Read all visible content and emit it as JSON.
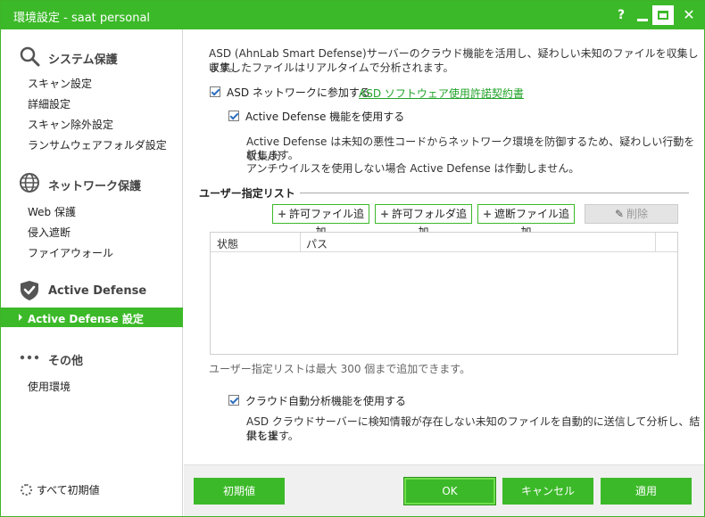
{
  "window": {
    "title": "環境設定 - saat personal",
    "help_label": "?",
    "close_label": "✕"
  },
  "sidebar": {
    "sections": [
      {
        "icon": "search-icon",
        "label": "システム保護",
        "items": [
          "スキャン設定",
          "詳細設定",
          "スキャン除外設定",
          "ランサムウェアフォルダ設定"
        ]
      },
      {
        "icon": "globe-icon",
        "label": "ネットワーク保護",
        "items": [
          "Web 保護",
          "侵入遮断",
          "ファイアウォール"
        ]
      },
      {
        "icon": "shield-check-icon",
        "label": "Active Defense",
        "items": [
          "Active Defense 設定"
        ]
      },
      {
        "icon": "more-icon",
        "label": "その他",
        "items": [
          "使用環境"
        ]
      }
    ],
    "active_item": "Active Defense 設定",
    "reset_all_label": "すべて初期値"
  },
  "content": {
    "intro_line1": "ASD (AhnLab Smart Defense)サーバーのクラウド機能を活用し、疑わしい未知のファイルを収集します。",
    "intro_line2": "収集したファイルはリアルタイムで分析されます。",
    "asd_checkbox": {
      "label": "ASD ネットワークに参加する",
      "checked": true
    },
    "license_link": "ASD ソフトウェア使用許諾契約書",
    "active_defense_checkbox": {
      "label": "Active Defense 機能を使用する",
      "checked": true
    },
    "ad_desc_line1": "Active Defense は未知の悪性コードからネットワーク環境を防御するため、疑わしい行動を収集/分",
    "ad_desc_line2": "析します。",
    "ad_desc_line3": "アンチウイルスを使用しない場合 Active Defense は作動しません。",
    "user_list_title": "ユーザー指定リスト",
    "buttons": {
      "add_file": "許可ファイル追加",
      "add_folder": "許可フォルダ追加",
      "block_file": "遮断ファイル追加",
      "delete": "削除"
    },
    "table": {
      "columns": [
        "状態",
        "パス"
      ],
      "rows": []
    },
    "list_note": "ユーザー指定リストは最大 300 個まで追加できます。",
    "cloud_checkbox": {
      "label": "クラウド自動分析機能を使用する",
      "checked": true
    },
    "cloud_desc_line1": "ASD クラウドサーバーに検知情報が存在しない未知のファイルを自動的に送信して分析し、結果を提",
    "cloud_desc_line2": "供します。"
  },
  "footer": {
    "default_label": "初期値",
    "ok_label": "OK",
    "cancel_label": "キャンセル",
    "apply_label": "適用"
  },
  "colors": {
    "accent": "#3cb929",
    "link": "#22a32a"
  }
}
